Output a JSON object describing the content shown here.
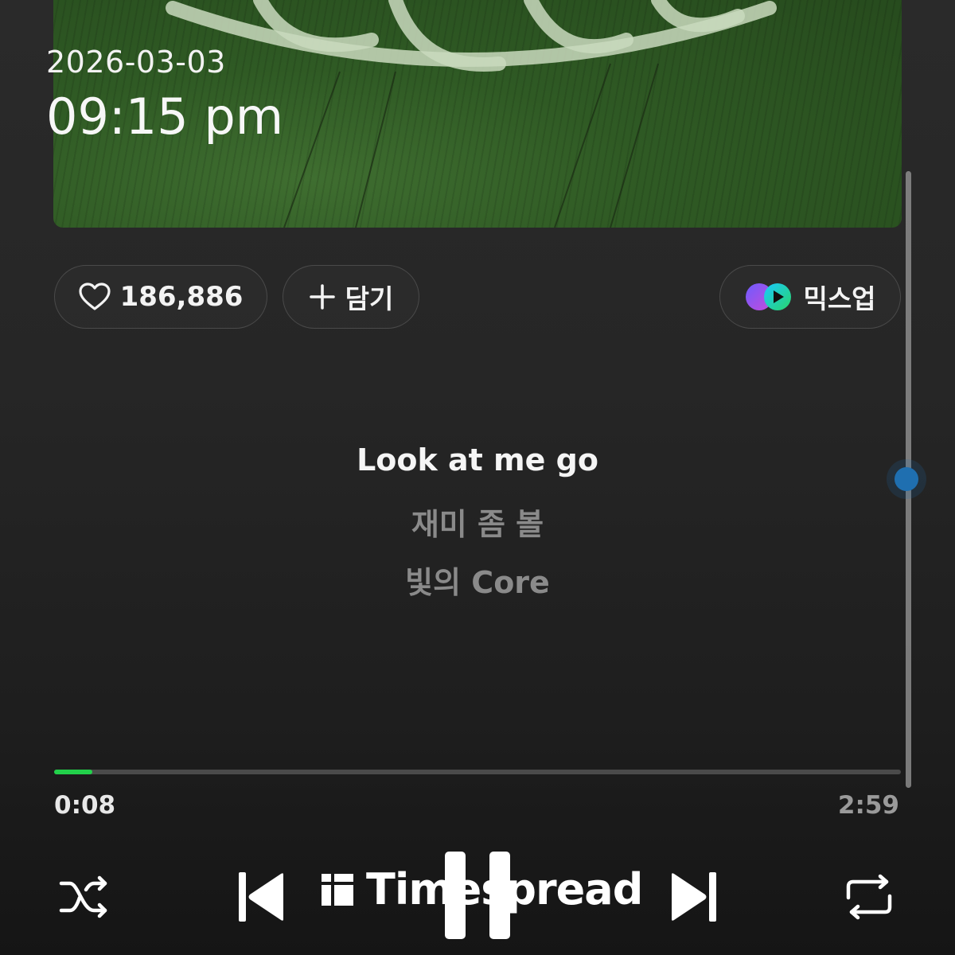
{
  "status": {
    "date": "2026-03-03",
    "time": "09:15 pm"
  },
  "actions": {
    "like_count": "186,886",
    "add_label": "담기",
    "mixup_label": "믹스업"
  },
  "lyrics": {
    "current": "Look at me go",
    "next1": "재미 좀 볼",
    "next2": "빛의 Core"
  },
  "progress": {
    "elapsed": "0:08",
    "total": "2:59",
    "fraction": 0.045,
    "fill_color": "#22d04a"
  },
  "scrollbar": {
    "position_fraction": 0.48,
    "knob_color": "#1f6fb0"
  },
  "controls": {
    "shuffle_icon": "shuffle-icon",
    "previous_icon": "previous-icon",
    "pause_icon": "pause-icon",
    "next_icon": "next-icon",
    "repeat_icon": "repeat-icon"
  },
  "watermark": {
    "text": "Timespread"
  },
  "colors": {
    "accent_green": "#22d04a",
    "background": "#262626"
  }
}
